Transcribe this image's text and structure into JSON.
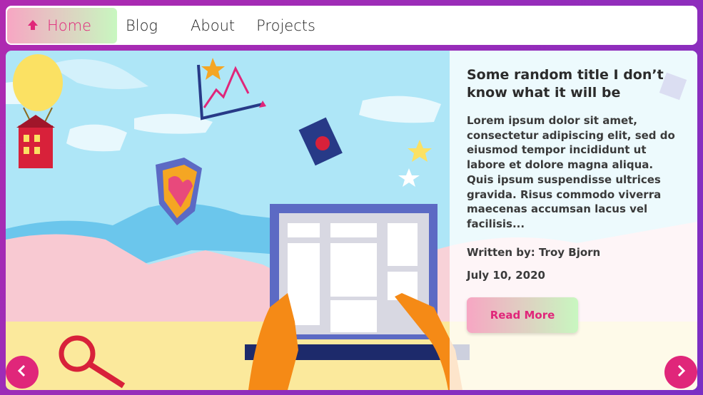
{
  "nav": {
    "home_label": "Home",
    "blog_label": "Blog",
    "about_label": "About",
    "projects_label": "Projects"
  },
  "post": {
    "title": "Some random title I don’t know what it will be",
    "body": "Lorem ipsum dolor sit amet, consectetur adipiscing elit, sed do eiusmod tempor incididunt ut labore et dolore magna aliqua. Quis ipsum suspendisse ultrices gravida. Risus commodo viverra maecenas accumsan lacus vel facilisis...",
    "author": "Written by: Troy Bjorn",
    "date": "July 10, 2020",
    "read_more_label": "Read More"
  },
  "colors": {
    "accent": "#e0267a",
    "frame": "#b02ab0",
    "sky": "#aee6f7",
    "button_gradient_start": "#f7a6c3",
    "button_gradient_end": "#c8f7c0"
  },
  "icons": {
    "home": "home-arrow-icon",
    "prev": "chevron-left-icon",
    "next": "chevron-right-icon"
  }
}
